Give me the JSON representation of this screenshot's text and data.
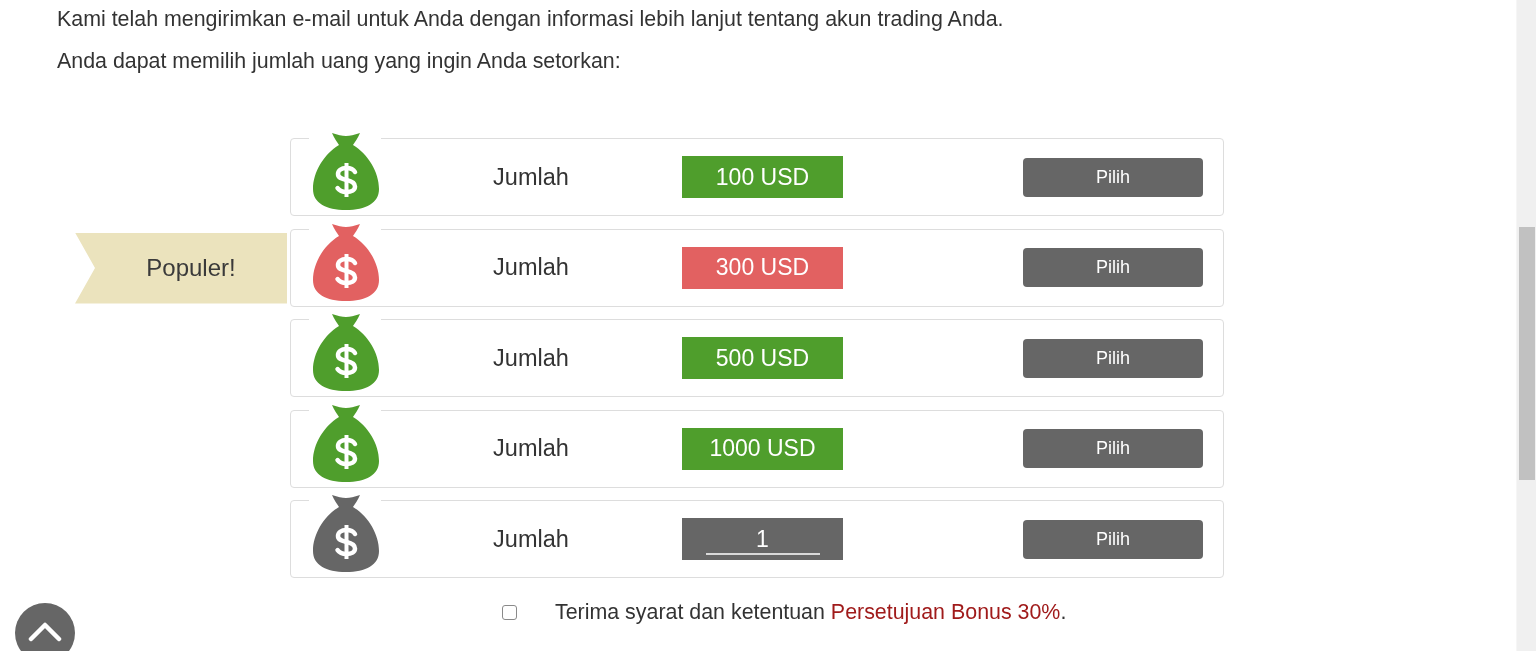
{
  "intro": [
    "Kami telah mengirimkan e-mail untuk Anda dengan informasi lebih lanjut tentang akun trading Anda.",
    "Anda dapat memilih jumlah uang yang ingin Anda setorkan:"
  ],
  "options": [
    {
      "kind": "fixed",
      "color": "#4f9e2c",
      "label": "Jumlah",
      "amount": "100 USD",
      "button": "Pilih"
    },
    {
      "kind": "fixed",
      "color": "#e26161",
      "label": "Jumlah",
      "amount": "300 USD",
      "button": "Pilih",
      "ribbon": "Populer!"
    },
    {
      "kind": "fixed",
      "color": "#4f9e2c",
      "label": "Jumlah",
      "amount": "500 USD",
      "button": "Pilih"
    },
    {
      "kind": "fixed",
      "color": "#4f9e2c",
      "label": "Jumlah",
      "amount": "1000 USD",
      "button": "Pilih"
    },
    {
      "kind": "custom",
      "color": "#666666",
      "label": "Jumlah",
      "value": "1",
      "button": "Pilih"
    }
  ],
  "terms": {
    "checked": false,
    "text": "Terima syarat dan ketentuan",
    "link": "Persetujuan Bonus 30%",
    "suffix": "."
  }
}
